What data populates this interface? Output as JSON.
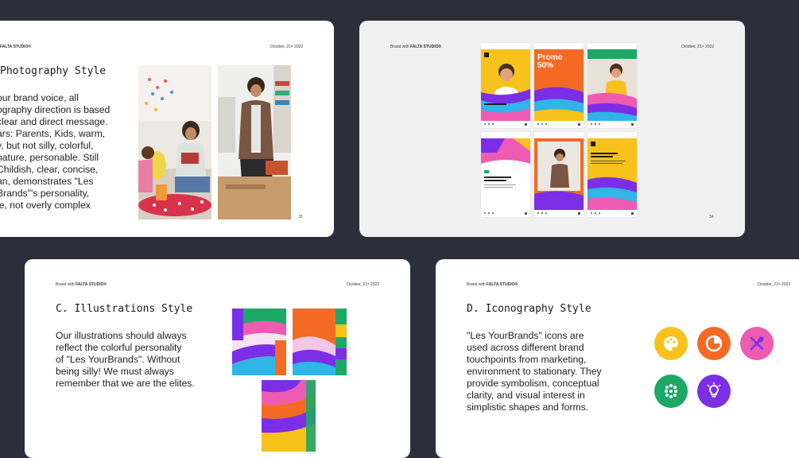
{
  "slides": {
    "photography": {
      "brand_prefix": "Brand with",
      "brand_name": "FALTA STUDIO®",
      "date": "October, 21ˢᵗ 2022",
      "title": "Photography Style",
      "body_lines": [
        "our brand voice, all",
        "ography direction is based",
        "clear and direct message.",
        "ars: Parents, Kids, warm,",
        "y, but not silly, colorful,",
        "nature, personable. Still",
        "Childish, clear, concise,",
        "an, demonstrates \"Les",
        "Brands\"'s personality,",
        "le, not overly complex"
      ],
      "page_number": "33"
    },
    "social": {
      "brand_prefix": "Brand with",
      "brand_name": "FALTA STUDIO®",
      "date": "October, 21ˢᵗ 2022",
      "promo_title": "Promo",
      "promo_value": "50%",
      "page_number": "34"
    },
    "illustrations": {
      "brand_prefix": "Brand with",
      "brand_name": "FALTA STUDIO®",
      "date": "October, 21ˢᵗ 2022",
      "title": "C.  Illustrations Style",
      "body_lines": [
        "Our illustrations should always",
        "reflect the colorful personality",
        "of \"Les YourBrands\". Without",
        "being silly! We must always",
        "remember that we are the elites."
      ]
    },
    "iconography": {
      "brand_prefix": "Brand with",
      "brand_name": "FALTA STUDIO®",
      "date": "October, 21ˢᵗ 2022",
      "title": "D.  Iconography Style",
      "body_lines": [
        "\"Les YourBrands\" icons are",
        "used across different brand",
        "touchpoints from marketing,",
        "environment to stationary. They",
        "provide symbolism, conceptual",
        "clarity, and visual interest in",
        "simplistic shapes and forms."
      ],
      "icons": [
        {
          "name": "palette-icon",
          "color": "#f7c21b"
        },
        {
          "name": "pie-chart-icon",
          "color": "#f46a24"
        },
        {
          "name": "utensils-icon",
          "color": "#ee5bb2"
        },
        {
          "name": "dots-grid-icon",
          "color": "#1ea865"
        },
        {
          "name": "lightbulb-icon",
          "color": "#7b2ee6"
        }
      ]
    }
  },
  "colors": {
    "background": "#2c2f3b",
    "yellow": "#f7c21b",
    "orange": "#f46a24",
    "pink": "#ee5bb2",
    "green": "#1ea865",
    "purple": "#7b2ee6",
    "blue": "#2fb5e8"
  }
}
